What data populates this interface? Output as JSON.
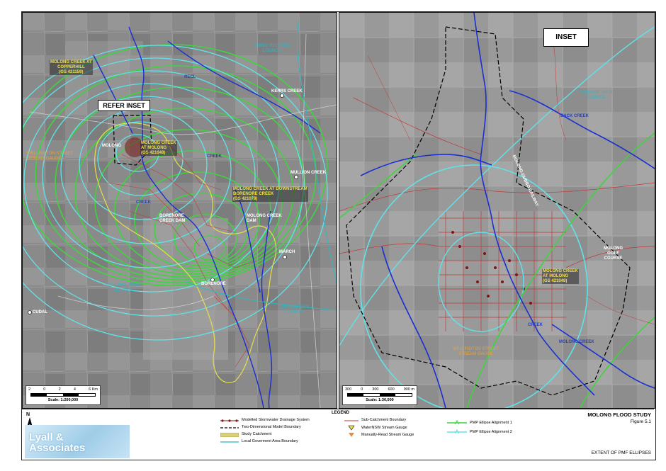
{
  "left_map": {
    "refer_inset": "REFER INSET",
    "labels": {
      "dubbo": "DUBBO REGIONAL\nCOUNCIL",
      "kerrs_creek": "KERRS CREEK",
      "mullion_creek": "MULLION CREEK",
      "march": "MARCH",
      "cudal": "CUDAL",
      "borenore": "BORENORE",
      "borenore_dam": "BORENORE\nCREEK DAM",
      "molong_creek_dam": "MOLONG CREEK\nDAM",
      "cabonne": "CABONNE SHIRE\nCOUNCIL",
      "orange": "ORANGE CITY\nCOUNCIL",
      "molong": "MOLONG",
      "wellington_gauge": "WELLINGTON STREET\nSTREAM GAUGE",
      "gauge_copperhill": "MOLONG CREEK AT\nCOPPERHILL\n(GS 421159)",
      "gauge_molong": "MOLONG CREEK\nAT MOLONG\n(GS 421048)",
      "gauge_downstream": "MOLONG CREEK AT DOWNSTREAM\nBORENORE CREEK\n(GS 421078)",
      "creek": "CREEK",
      "creek2": "CREEK",
      "recl": "RECL"
    },
    "scale_ticks": [
      "2",
      "0",
      "2",
      "4",
      "6 Km"
    ],
    "scale_text": "Scale: 1:200,000"
  },
  "right_map": {
    "inset": "INSET",
    "labels": {
      "cabonne": "CABONNE SHIRE\nCOUNCIL",
      "back_creek": "BACK CREEK",
      "molong_golf": "MOLONG\nGOLF\nCOURSE",
      "gauge_molong": "MOLONG CREEK\nAT MOLONG\n(GS 421048)",
      "wellington_gauge": "WELLINGTON STREET\nSTREAM GAUGE",
      "molong_creek": "MOLONG CREEK",
      "creek": "CREEK",
      "railway": "MOLONG-DUBBO RAILWAY"
    },
    "scale_ticks": [
      "300",
      "0",
      "300",
      "600",
      "900 m"
    ],
    "scale_text": "Scale: 1:30,000"
  },
  "legend": {
    "title": "LEGEND",
    "items": [
      "Modelled Stormwater Drainage System",
      "Two-Dimensional Model Boundary",
      "Study Catchment",
      "Local Goverment Area Boundary",
      "Sub-Catchment Boundary",
      "WaterNSW Stream Gauge",
      "Manually-Read Stream Gauge",
      "PMP Ellipse Alignment 1",
      "PMP Ellipse Alignment 2"
    ]
  },
  "north": "N",
  "logo": "Lyall &\nAssociates",
  "title_block": {
    "title": "MOLONG FLOOD STUDY",
    "figure": "Figure 5.1",
    "subtitle": "EXTENT OF PMF ELLIPSES"
  },
  "colors": {
    "ellipse1": "#3fd43f",
    "ellipse2": "#5fe3ea",
    "river": "#1a2fd0",
    "catchment": "#e8de4a",
    "subcatchment": "#c23a3a",
    "model_boundary": "#000000",
    "lga": "#2fb7c4"
  }
}
